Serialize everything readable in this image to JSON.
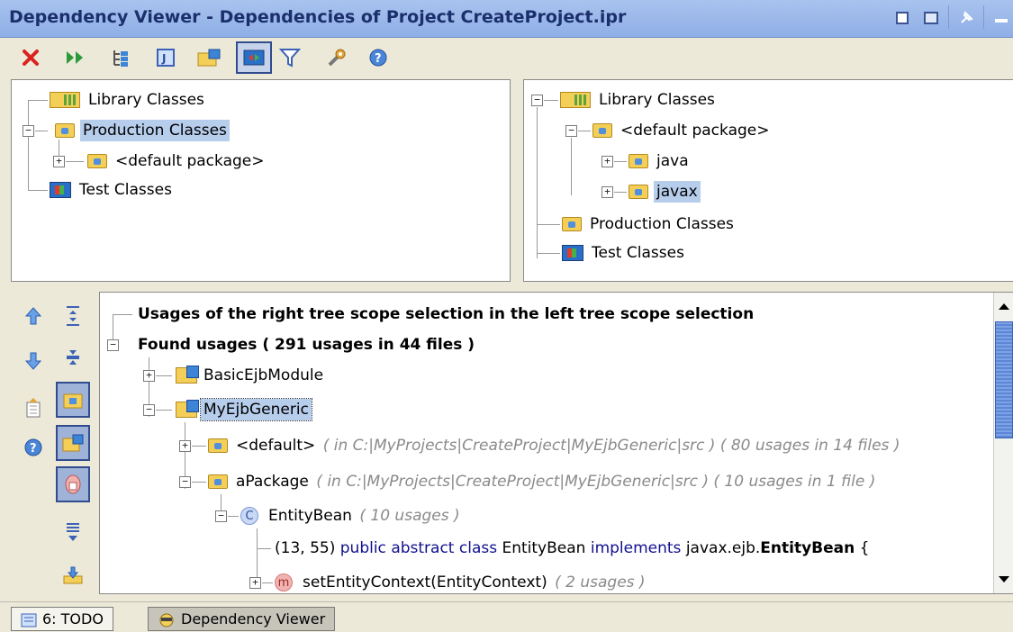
{
  "window": {
    "title": "Dependency Viewer - Dependencies of Project CreateProject.ipr"
  },
  "title_buttons": [
    "restore-icon",
    "window-icon",
    "pin-icon",
    "minimize-icon"
  ],
  "toolbar": {
    "icons": [
      "close-icon",
      "rerun-icon",
      "group-by-scope-icon",
      "jar-icon",
      "folder-module-icon",
      "show-dependencies-icon",
      "filter-icon",
      "settings-icon",
      "help-icon"
    ],
    "colors": {
      "close": "#d9231f",
      "rerun": "#2a9a3a"
    }
  },
  "left_tree": {
    "library": "Library Classes",
    "production": "Production Classes",
    "default_package": "<default package>",
    "test": "Test Classes"
  },
  "right_tree": {
    "library": "Library Classes",
    "default_package": "<default package>",
    "java": "java",
    "javax": "javax",
    "production": "Production Classes",
    "test": "Test Classes"
  },
  "sidebar": {
    "icons": [
      "previous-occurrence-icon",
      "next-occurrence-icon",
      "export-icon",
      "help-icon",
      "expand-all-icon",
      "collapse-all-icon",
      "group-by-package-icon",
      "group-by-module-icon",
      "group-by-scope-icon",
      "autoscroll-icon",
      "import-icon"
    ]
  },
  "usages": {
    "header": "Usages of the right tree scope selection in the left tree scope selection",
    "found": "Found usages ( 291 usages in 44 files )",
    "basic_module": "BasicEjbModule",
    "generic_module": "MyEjbGeneric",
    "default_pkg": "<default>",
    "default_pkg_info": "( in C:|MyProjects|CreateProject|MyEjbGeneric|src ) ( 80 usages in 14 files )",
    "apackage": "aPackage",
    "apackage_info": "( in C:|MyProjects|CreateProject|MyEjbGeneric|src ) ( 10 usages in 1 file )",
    "entity_bean": "EntityBean",
    "entity_bean_info": "( 10 usages )",
    "code_pos": "(13, 55)",
    "code_public": "public",
    "code_abstract": "abstract",
    "code_class": "class",
    "code_name": "EntityBean",
    "code_implements": "implements",
    "code_pkg": "javax.ejb.",
    "code_iface": "EntityBean",
    "code_brace": "{",
    "method": "setEntityContext(EntityContext)",
    "method_info": "( 2 usages )"
  },
  "bottom_tabs": {
    "todo": "6: TODO",
    "dependency_viewer": "Dependency Viewer"
  }
}
